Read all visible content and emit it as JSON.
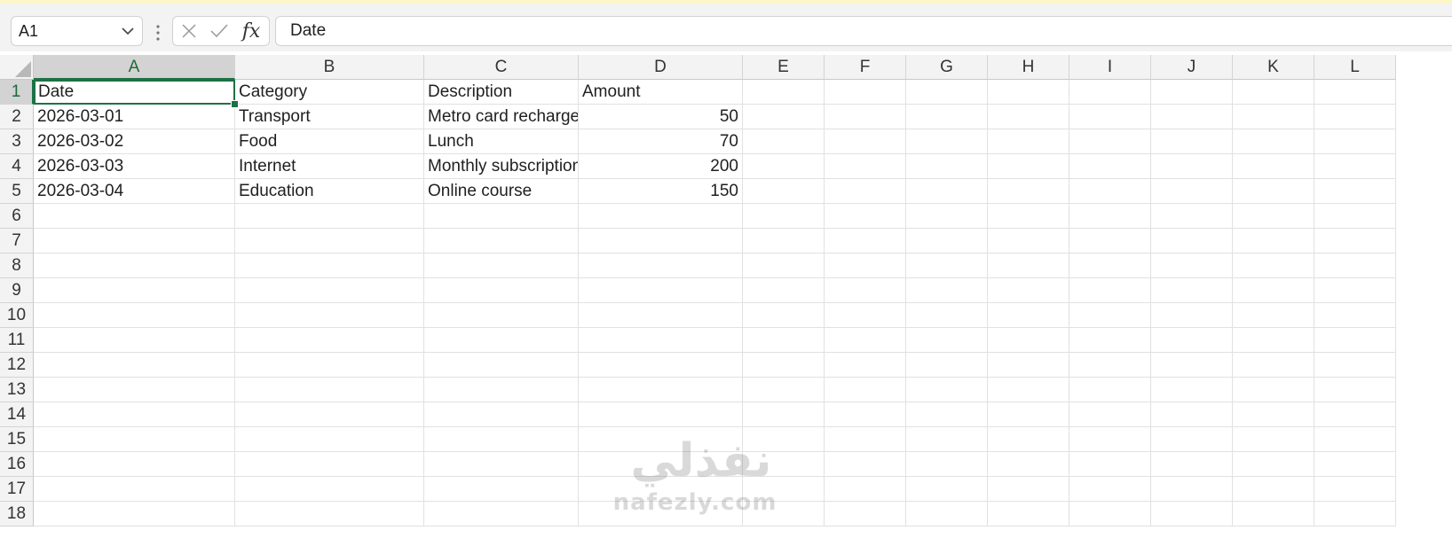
{
  "name_box": {
    "value": "A1"
  },
  "formula_bar": {
    "value": "Date",
    "fx_label": "fx"
  },
  "columns": [
    "A",
    "B",
    "C",
    "D",
    "E",
    "F",
    "G",
    "H",
    "I",
    "J",
    "K",
    "L"
  ],
  "rows": [
    "1",
    "2",
    "3",
    "4",
    "5",
    "6",
    "7",
    "8",
    "9",
    "10",
    "11",
    "12",
    "13",
    "14",
    "15",
    "16",
    "17",
    "18"
  ],
  "active_cell": "A1",
  "cells": [
    [
      "Date",
      "Category",
      "Description",
      "Amount"
    ],
    [
      "2026-03-01",
      "Transport",
      "Metro card recharge",
      "50"
    ],
    [
      "2026-03-02",
      "Food",
      "Lunch",
      "70"
    ],
    [
      "2026-03-03",
      "Internet",
      "Monthly subscription",
      "200"
    ],
    [
      "2026-03-04",
      "Education",
      "Online course",
      "150"
    ]
  ],
  "watermark": {
    "arabic": "نفذلي",
    "latin": "nafezly.com"
  },
  "colors": {
    "accent": "#1e7145",
    "header_bg": "#f3f3f3",
    "selected_header_bg": "#d3d3d3",
    "gridline": "#e1e1e1"
  }
}
